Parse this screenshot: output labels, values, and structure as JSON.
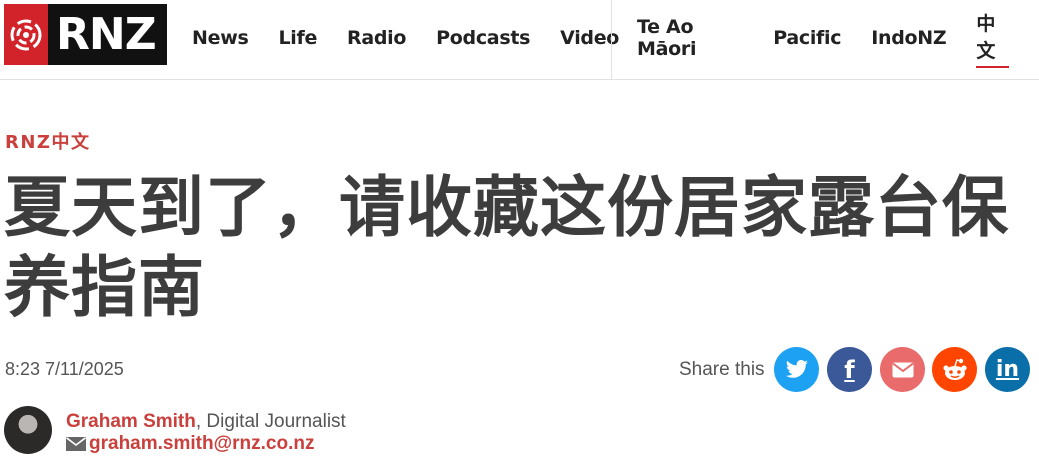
{
  "header": {
    "logo_text": "RNZ",
    "nav_left": [
      "News",
      "Life",
      "Radio",
      "Podcasts",
      "Video"
    ],
    "nav_right": [
      "Te Ao Māori",
      "Pacific",
      "IndoNZ",
      "中文"
    ]
  },
  "article": {
    "section": "RNZ中文",
    "headline": "夏天到了，请收藏这份居家露台保养指南",
    "dateline": "8:23 7/11/2025",
    "share_label": "Share this"
  },
  "author": {
    "name": "Graham Smith",
    "role": ", Digital Journalist",
    "email": "graham.smith@rnz.co.nz"
  },
  "colors": {
    "brand_red": "#d2232a",
    "accent_red": "#c9403c",
    "twitter": "#1da1f2",
    "facebook": "#3b5998",
    "email": "#ea6b6b",
    "reddit": "#ff4500",
    "linkedin": "#0a6fa8"
  },
  "icons": {
    "share": [
      "twitter-icon",
      "facebook-icon",
      "email-icon",
      "reddit-icon",
      "linkedin-icon"
    ]
  }
}
